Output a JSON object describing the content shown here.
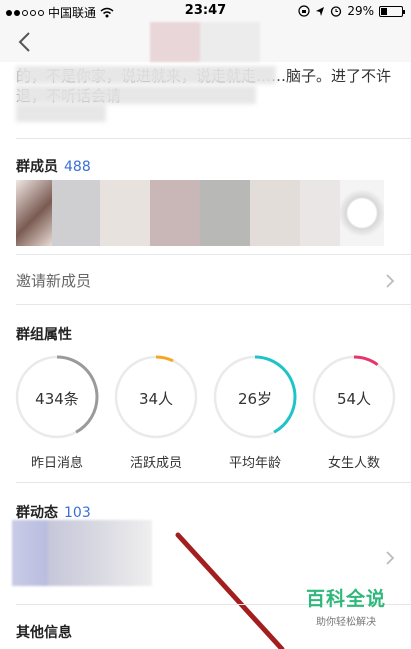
{
  "status_bar": {
    "carrier": "中国联通",
    "time": "23:47",
    "battery": "29%",
    "battery_level": 0.29
  },
  "group_intro": {
    "text": "的，不是你家，说进就来，说走就走……脑子。进了不许退，不听话会请"
  },
  "members_section": {
    "title": "群成员",
    "count": "488"
  },
  "invite": {
    "label": "邀请新成员"
  },
  "attributes": {
    "title": "群组属性",
    "stats": [
      {
        "value": "434条",
        "caption": "昨日消息",
        "ring_fraction": 0.42,
        "ring_color": "#9a9a9a"
      },
      {
        "value": "34人",
        "caption": "活跃成员",
        "ring_fraction": 0.07,
        "ring_color": "#f5a623"
      },
      {
        "value": "26岁",
        "caption": "平均年龄",
        "ring_fraction": 0.42,
        "ring_color": "#1fc4c8"
      },
      {
        "value": "54人",
        "caption": "女生人数",
        "ring_fraction": 0.1,
        "ring_color": "#e8336b"
      }
    ]
  },
  "dynamics_section": {
    "title": "群动态",
    "count": "103"
  },
  "other_info": {
    "title": "其他信息"
  },
  "watermark": {
    "title": "百科全说",
    "subtitle": "助你轻松解决"
  },
  "colors": {
    "accent": "#3a6fd8",
    "divider": "#e6e6e6"
  }
}
